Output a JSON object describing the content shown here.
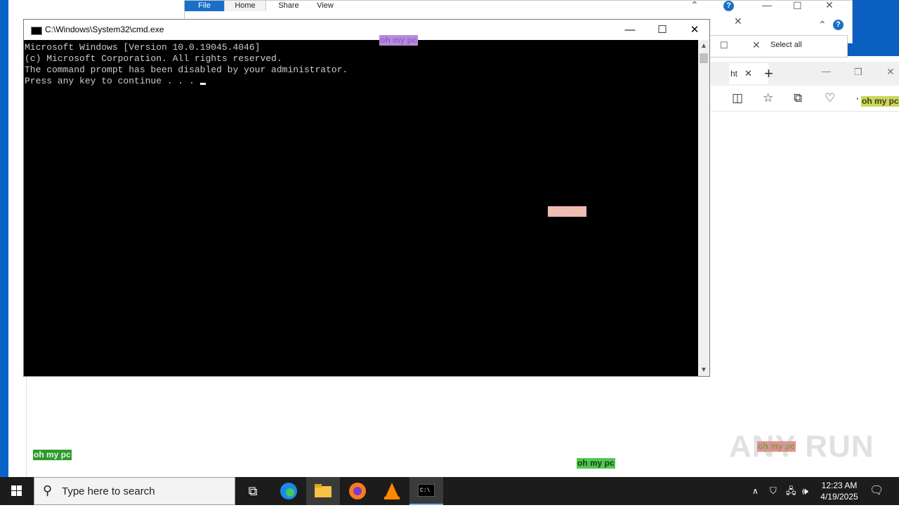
{
  "explorer": {
    "tabs": [
      "File",
      "Home",
      "Share",
      "View"
    ],
    "select_all": "Select all"
  },
  "cmd": {
    "title": "C:\\Windows\\System32\\cmd.exe",
    "lines": [
      "Microsoft Windows [Version 10.0.19045.4046]",
      "(c) Microsoft Corporation. All rights reserved.",
      "",
      "The command prompt has been disabled by your administrator.",
      "",
      "Press any key to continue . . . "
    ]
  },
  "edge": {
    "tab_label": "ht",
    "new_tab": "+"
  },
  "tags": {
    "text": "oh my pc",
    "colors": [
      "#b48cd8",
      "#f2a3a3",
      "#2e9a2e",
      "#4fc94f",
      "#c8d85a",
      "#e89090"
    ]
  },
  "taskbar": {
    "search_placeholder": "Type here to search",
    "time": "12:23 AM",
    "date": "4/19/2025"
  },
  "watermark": "ANY RUN"
}
